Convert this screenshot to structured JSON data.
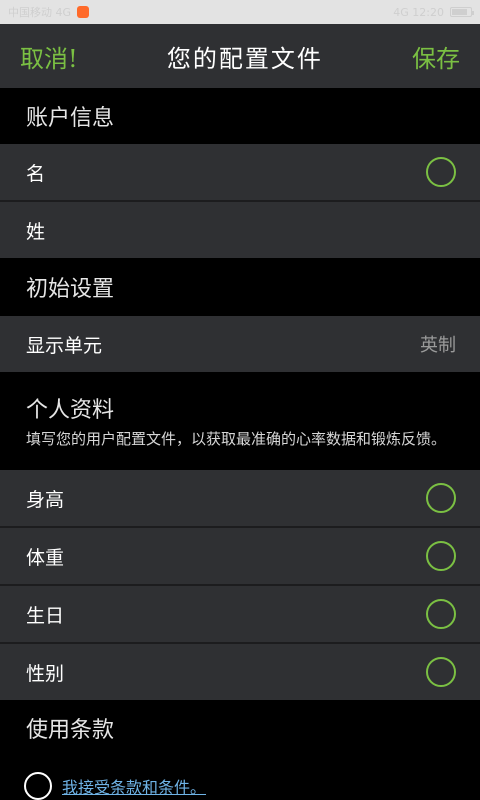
{
  "status": {
    "left_text": "中国移动 4G",
    "right_text": "4G 12:20"
  },
  "header": {
    "cancel_label": "取消!",
    "title": "您的配置文件",
    "save_label": "保存"
  },
  "sections": {
    "account": "账户信息",
    "initial_settings": "初始设置",
    "profile": {
      "title": "个人资料",
      "desc": "填写您的用户配置文件，以获取最准确的心率数据和锻炼反馈。"
    },
    "terms": "使用条款"
  },
  "rows": {
    "first_name": "名",
    "last_name": "姓",
    "display_unit": {
      "label": "显示单元",
      "value": "英制"
    },
    "height": "身高",
    "weight": "体重",
    "birthday": "生日",
    "gender": "性别"
  },
  "terms": {
    "agree_link": "我接受条款和条件。"
  }
}
